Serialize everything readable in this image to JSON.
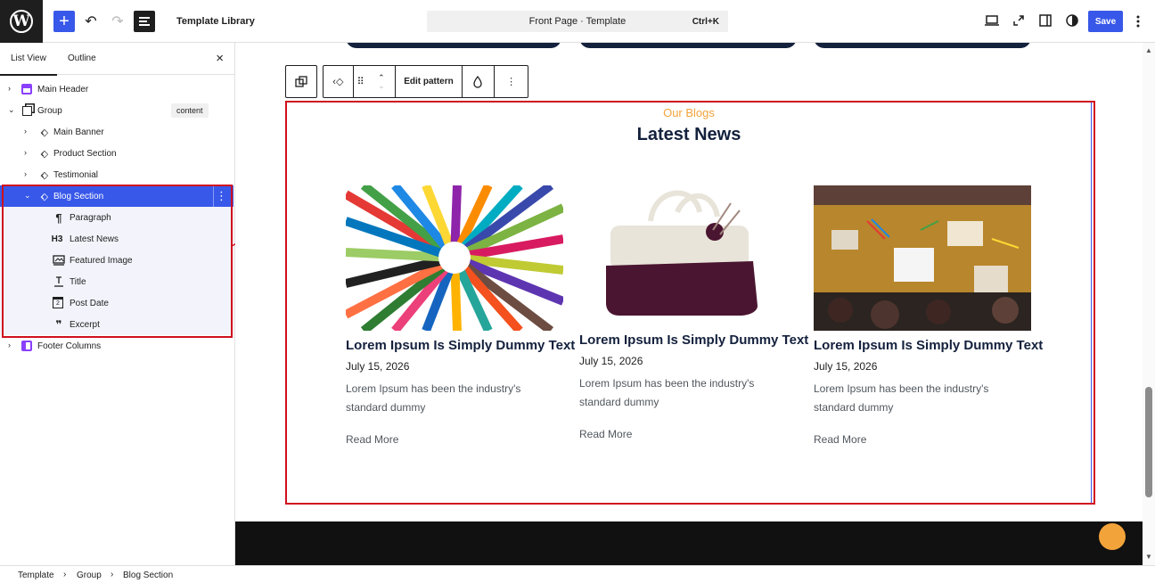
{
  "topbar": {
    "logo_glyph": "W",
    "add_icon": "+",
    "undo_icon": "↶",
    "redo_icon": "↷",
    "title": "Template Library",
    "command": "Front Page · Template",
    "shortcut": "Ctrl+K",
    "save_label": "Save",
    "icons": [
      "desktop-preview-icon",
      "external-link-icon",
      "sidebar-toggle-icon",
      "style-contrast-icon",
      "options-kebab-icon"
    ]
  },
  "sidebar": {
    "tab_list": "List View",
    "tab_outline": "Outline",
    "close_icon": "×",
    "items": [
      {
        "label": "Main Header"
      },
      {
        "label": "Group",
        "badge": "content"
      },
      {
        "label": "Main Banner"
      },
      {
        "label": "Product Section"
      },
      {
        "label": "Testimonial"
      },
      {
        "label": "Blog Section"
      },
      {
        "label": "Paragraph",
        "icon": "¶"
      },
      {
        "label": "Latest News",
        "icon": "H3"
      },
      {
        "label": "Featured Image"
      },
      {
        "label": "Title"
      },
      {
        "label": "Post Date",
        "icon": "2"
      },
      {
        "label": "Excerpt",
        "icon": "❞"
      },
      {
        "label": "Footer Columns"
      }
    ]
  },
  "breadcrumb": [
    "Template",
    "Group",
    "Blog Section"
  ],
  "block_toolbar": {
    "edit_label": "Edit pattern"
  },
  "blog": {
    "eyebrow": "Our Blogs",
    "heading": "Latest News",
    "posts": [
      {
        "title": "Lorem Ipsum Is Simply Dummy Text",
        "date": "July 15, 2026",
        "excerpt": "Lorem Ipsum has been the industry's standard dummy",
        "more": "Read More",
        "image": "colored-pencils"
      },
      {
        "title": "Lorem Ipsum Is Simply Dummy Text",
        "date": "July 15, 2026",
        "excerpt": "Lorem Ipsum has been the industry's standard dummy",
        "more": "Read More",
        "image": "knitted-bag"
      },
      {
        "title": "Lorem Ipsum Is Simply Dummy Text",
        "date": "July 15, 2026",
        "excerpt": "Lorem Ipsum has been the industry's standard dummy",
        "more": "Read More",
        "image": "kids-crafting-table"
      }
    ]
  },
  "colors": {
    "accent": "#3858e9",
    "highlight": "#d0101e",
    "navy": "#14213d",
    "orange": "#f2a33a"
  }
}
